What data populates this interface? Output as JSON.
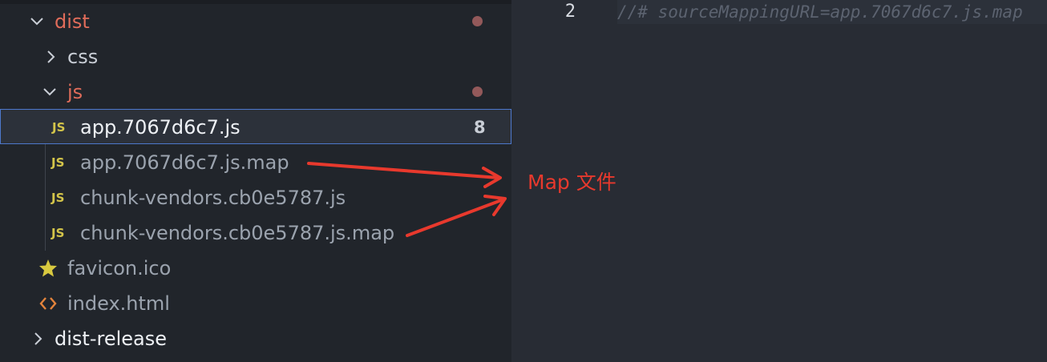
{
  "explorer": {
    "items": [
      {
        "label": "dist",
        "type": "folder",
        "expanded": true,
        "modified": true
      },
      {
        "label": "css",
        "type": "folder",
        "expanded": false
      },
      {
        "label": "js",
        "type": "folder",
        "expanded": true,
        "modified": true
      },
      {
        "label": "app.7067d6c7.js",
        "type": "file",
        "icon": "js-file-icon",
        "icon_text": "JS",
        "badge": "8",
        "selected": true
      },
      {
        "label": "app.7067d6c7.js.map",
        "type": "file",
        "icon": "js-file-icon",
        "icon_text": "JS"
      },
      {
        "label": "chunk-vendors.cb0e5787.js",
        "type": "file",
        "icon": "js-file-icon",
        "icon_text": "JS"
      },
      {
        "label": "chunk-vendors.cb0e5787.js.map",
        "type": "file",
        "icon": "js-file-icon",
        "icon_text": "JS"
      },
      {
        "label": "favicon.ico",
        "type": "file",
        "icon": "star-icon"
      },
      {
        "label": "index.html",
        "type": "file",
        "icon": "html-brackets-icon"
      },
      {
        "label": "dist-release",
        "type": "folder",
        "expanded": false
      }
    ]
  },
  "editor": {
    "line_number": "2",
    "code": "//# sourceMappingURL=app.7067d6c7.js.map"
  },
  "annotation": {
    "text": "Map 文件"
  },
  "colors": {
    "modified_folder": "#e06c5a",
    "annotation_red": "#e8392d",
    "selection_border": "#4d78cc",
    "js_icon": "#d4c54a",
    "star_icon": "#d8c93f",
    "html_icon": "#e3843c"
  }
}
